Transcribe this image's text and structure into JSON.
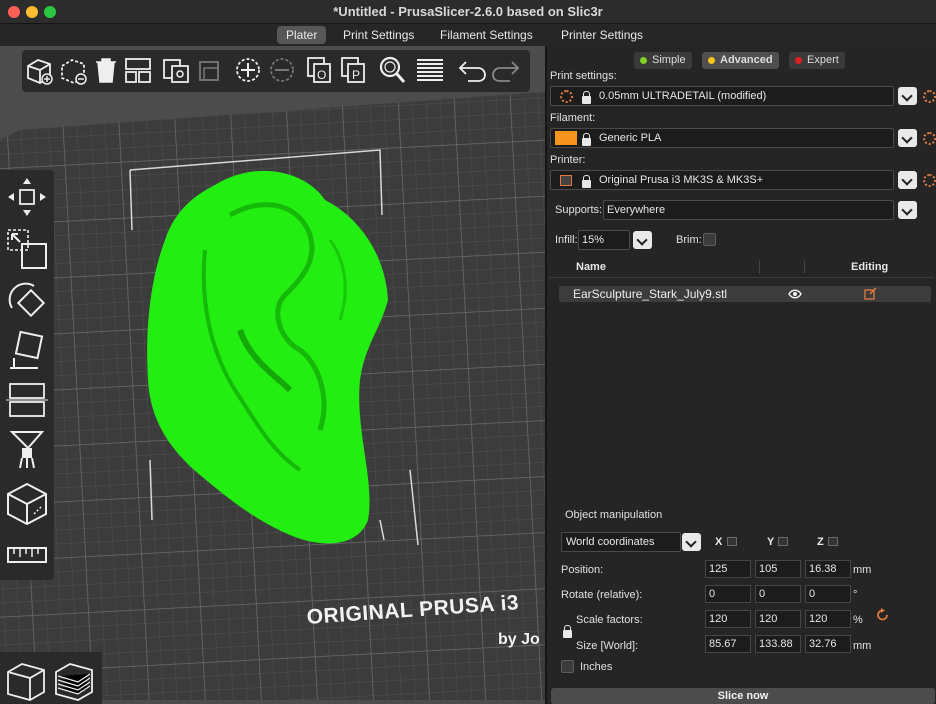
{
  "window": {
    "title": "*Untitled - PrusaSlicer-2.6.0 based on Slic3r"
  },
  "tabs": [
    {
      "label": "Plater"
    },
    {
      "label": "Print Settings"
    },
    {
      "label": "Filament Settings"
    },
    {
      "label": "Printer Settings"
    }
  ],
  "bed": {
    "label": "ORIGINAL PRUSA i3",
    "sublabel": "by Jo"
  },
  "mode": {
    "simple": "Simple",
    "advanced": "Advanced",
    "expert": "Expert",
    "colors": {
      "simple": "#7ed321",
      "advanced": "#f5c518",
      "expert": "#e02020"
    }
  },
  "print_settings": {
    "label": "Print settings:",
    "value": "0.05mm ULTRADETAIL (modified)"
  },
  "filament": {
    "label": "Filament:",
    "value": "Generic PLA",
    "color": "#f7941d"
  },
  "printer": {
    "label": "Printer:",
    "value": "Original Prusa i3 MK3S & MK3S+"
  },
  "supports": {
    "label": "Supports:",
    "value": "Everywhere"
  },
  "infill": {
    "label": "Infill:",
    "value": "15%"
  },
  "brim": {
    "label": "Brim:",
    "checked": false
  },
  "object_list": {
    "col_name": "Name",
    "col_editing": "Editing",
    "items": [
      {
        "name": "EarSculpture_Stark_July9.stl"
      }
    ]
  },
  "manipulation": {
    "title": "Object manipulation",
    "coords": "World coordinates",
    "axes": [
      "X",
      "Y",
      "Z"
    ],
    "position": {
      "label": "Position:",
      "x": "125",
      "y": "105",
      "z": "16.38",
      "unit": "mm"
    },
    "rotate": {
      "label": "Rotate (relative):",
      "x": "0",
      "y": "0",
      "z": "0",
      "unit": "°"
    },
    "scale": {
      "label": "Scale factors:",
      "x": "120",
      "y": "120",
      "z": "120",
      "unit": "%"
    },
    "size": {
      "label": "Size [World]:",
      "x": "85.67",
      "y": "133.88",
      "z": "32.76",
      "unit": "mm"
    },
    "inches": "Inches"
  },
  "slice_button": "Slice now",
  "model_color": "#22ee11"
}
